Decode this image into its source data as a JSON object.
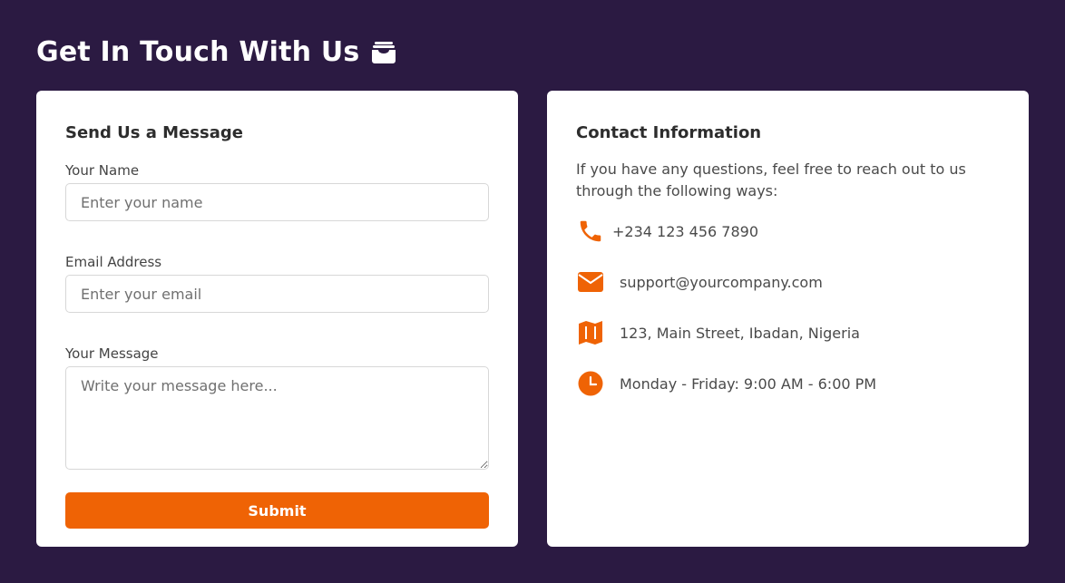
{
  "header": {
    "title": "Get In Touch With Us",
    "title_icon": "inbox-tray-icon"
  },
  "form": {
    "title": "Send Us a Message",
    "name_label": "Your Name",
    "name_placeholder": "Enter your name",
    "name_value": "",
    "email_label": "Email Address",
    "email_placeholder": "Enter your email",
    "email_value": "",
    "message_label": "Your Message",
    "message_placeholder": "Write your message here...",
    "message_value": "",
    "submit_label": "Submit"
  },
  "contact": {
    "title": "Contact Information",
    "intro": "If you have any questions, feel free to reach out to us through the following ways:",
    "items": [
      {
        "icon": "phone-icon",
        "text": "+234 123 456 7890"
      },
      {
        "icon": "envelope-icon",
        "text": "support@yourcompany.com"
      },
      {
        "icon": "map-icon",
        "text": "123, Main Street, Ibadan, Nigeria"
      },
      {
        "icon": "clock-icon",
        "text": "Monday - Friday: 9:00 AM - 6:00 PM"
      }
    ]
  },
  "colors": {
    "background": "#2b1a42",
    "accent": "#ef6305",
    "card": "#ffffff"
  }
}
